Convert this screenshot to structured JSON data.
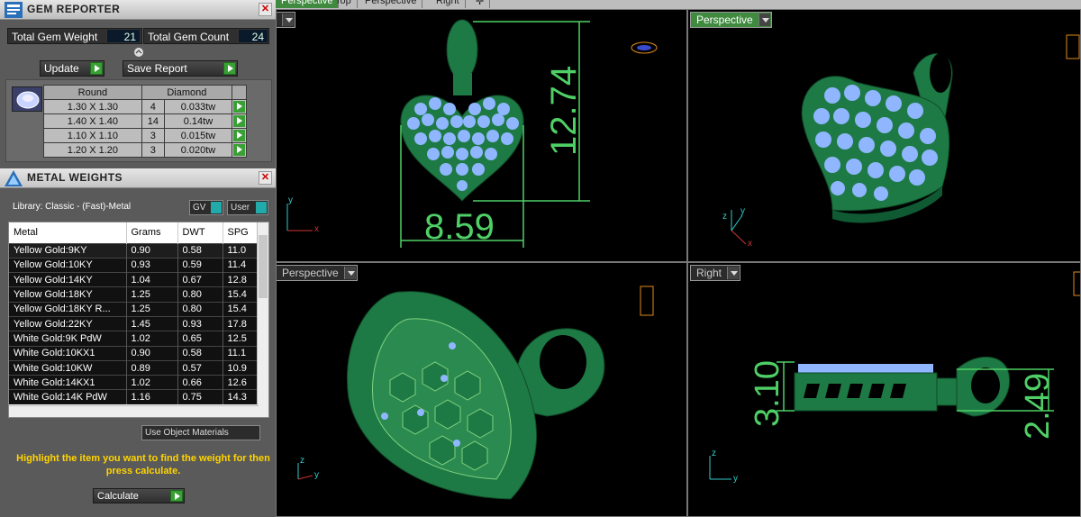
{
  "gem_reporter": {
    "title": "GEM REPORTER",
    "total_weight_label": "Total Gem Weight",
    "total_weight_value": "21",
    "total_count_label": "Total Gem Count",
    "total_count_value": "24",
    "update_label": "Update",
    "save_report_label": "Save Report",
    "table_headers": [
      "Round",
      "Diamond"
    ],
    "rows": [
      {
        "size": "1.30 X 1.30",
        "count": "4",
        "weight": "0.033tw"
      },
      {
        "size": "1.40 X 1.40",
        "count": "14",
        "weight": "0.14tw"
      },
      {
        "size": "1.10 X 1.10",
        "count": "3",
        "weight": "0.015tw"
      },
      {
        "size": "1.20 X 1.20",
        "count": "3",
        "weight": "0.020tw"
      }
    ]
  },
  "metal_weights": {
    "title": "METAL WEIGHTS",
    "library_label": "Library: Classic - (Fast)-Metal",
    "gv_label": "GV",
    "user_label": "User",
    "columns": [
      "Metal",
      "Grams",
      "DWT",
      "SPG"
    ],
    "rows": [
      {
        "metal": "Yellow Gold:9KY",
        "grams": "0.90",
        "dwt": "0.58",
        "spg": "11.0"
      },
      {
        "metal": "Yellow Gold:10KY",
        "grams": "0.93",
        "dwt": "0.59",
        "spg": "11.4"
      },
      {
        "metal": "Yellow Gold:14KY",
        "grams": "1.04",
        "dwt": "0.67",
        "spg": "12.8"
      },
      {
        "metal": "Yellow Gold:18KY",
        "grams": "1.25",
        "dwt": "0.80",
        "spg": "15.4"
      },
      {
        "metal": "Yellow Gold:18KY R...",
        "grams": "1.25",
        "dwt": "0.80",
        "spg": "15.4"
      },
      {
        "metal": "Yellow Gold:22KY",
        "grams": "1.45",
        "dwt": "0.93",
        "spg": "17.8"
      },
      {
        "metal": "White Gold:9K PdW",
        "grams": "1.02",
        "dwt": "0.65",
        "spg": "12.5"
      },
      {
        "metal": "White Gold:10KX1",
        "grams": "0.90",
        "dwt": "0.58",
        "spg": "11.1"
      },
      {
        "metal": "White Gold:10KW",
        "grams": "0.89",
        "dwt": "0.57",
        "spg": "10.9"
      },
      {
        "metal": "White Gold:14KX1",
        "grams": "1.02",
        "dwt": "0.66",
        "spg": "12.6"
      },
      {
        "metal": "White Gold:14K PdW",
        "grams": "1.16",
        "dwt": "0.75",
        "spg": "14.3"
      }
    ],
    "use_object_materials_label": "Use Object Materials",
    "hint": "Highlight the item you want to find the weight for then press calculate.",
    "calculate_label": "Calculate"
  },
  "tabs": [
    "Perspective",
    "Top",
    "Perspective",
    "Right"
  ],
  "viewports": {
    "top_right_label": "Perspective",
    "bottom_left_label": "Perspective",
    "bottom_right_label": "Right"
  },
  "dimensions": {
    "height": "12.74",
    "width": "8.59",
    "side_left": "3.10",
    "side_right": "2.49"
  },
  "axes": {
    "x": "x",
    "y": "y",
    "z": "z"
  },
  "colors": {
    "metal": "#1e7a45",
    "gem": "#8fb6ff",
    "dimension": "#4fd066",
    "active_tab": "#3f8a3f"
  }
}
